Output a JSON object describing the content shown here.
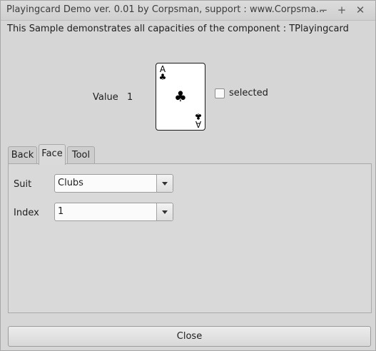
{
  "window": {
    "title": "Playingcard Demo ver. 0.01 by Corpsman, support : www.Corpsma...",
    "minimize_glyph": "−",
    "maximize_glyph": "+",
    "close_glyph": "✕"
  },
  "description": "This Sample demonstrates all capacities of the component : TPlayingcard",
  "value": {
    "label": "Value",
    "number": "1"
  },
  "card": {
    "rank": "A",
    "suit_symbol": "♣",
    "suit_name": "Clubs"
  },
  "selected_checkbox": {
    "label": "selected",
    "checked": false
  },
  "tabs": [
    {
      "label": "Back",
      "active": false
    },
    {
      "label": "Face",
      "active": true
    },
    {
      "label": "Tool",
      "active": false
    }
  ],
  "face_panel": {
    "suit_label": "Suit",
    "suit_value": "Clubs",
    "index_label": "Index",
    "index_value": "1"
  },
  "close_button": {
    "label": "Close"
  },
  "icons": {
    "minimize": "minimize-icon",
    "maximize": "maximize-icon",
    "close": "close-icon",
    "combo_arrow": "chevron-down-icon"
  }
}
